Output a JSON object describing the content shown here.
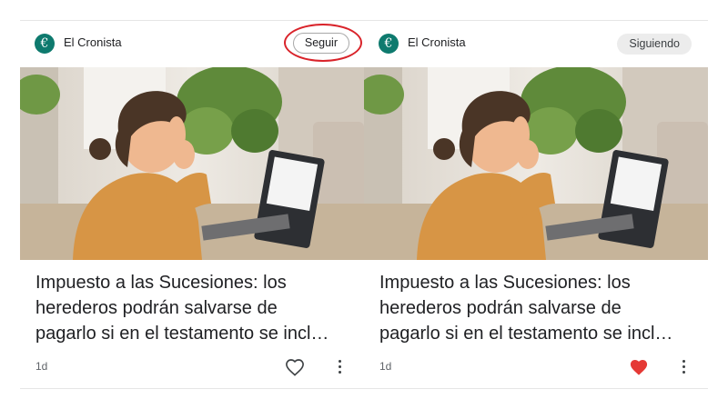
{
  "cards": [
    {
      "source": "El Cronista",
      "logo_glyph": "€",
      "follow_label": "Seguir",
      "follow_state": "not-following",
      "follow_highlighted": true,
      "headline_lines": [
        "Impuesto a las Sucesiones: los",
        "herederos podrán salvarse de",
        "pagarlo si en el testamento se incl…"
      ],
      "age": "1d",
      "liked": false,
      "like_icon": "heart-outline-icon",
      "more_icon": "more-vertical-icon"
    },
    {
      "source": "El Cronista",
      "logo_glyph": "€",
      "follow_label": "Siguiendo",
      "follow_state": "following",
      "follow_highlighted": false,
      "headline_lines": [
        "Impuesto a las Sucesiones: los",
        "herederos podrán salvarse de",
        "pagarlo si en el testamento se incl…"
      ],
      "age": "1d",
      "liked": true,
      "like_icon": "heart-filled-icon",
      "more_icon": "more-vertical-icon"
    }
  ],
  "colors": {
    "brand_logo": "#0e7a6e",
    "highlight_ring": "#d9232a",
    "heart_filled": "#e53935",
    "following_bg": "#ececec"
  }
}
